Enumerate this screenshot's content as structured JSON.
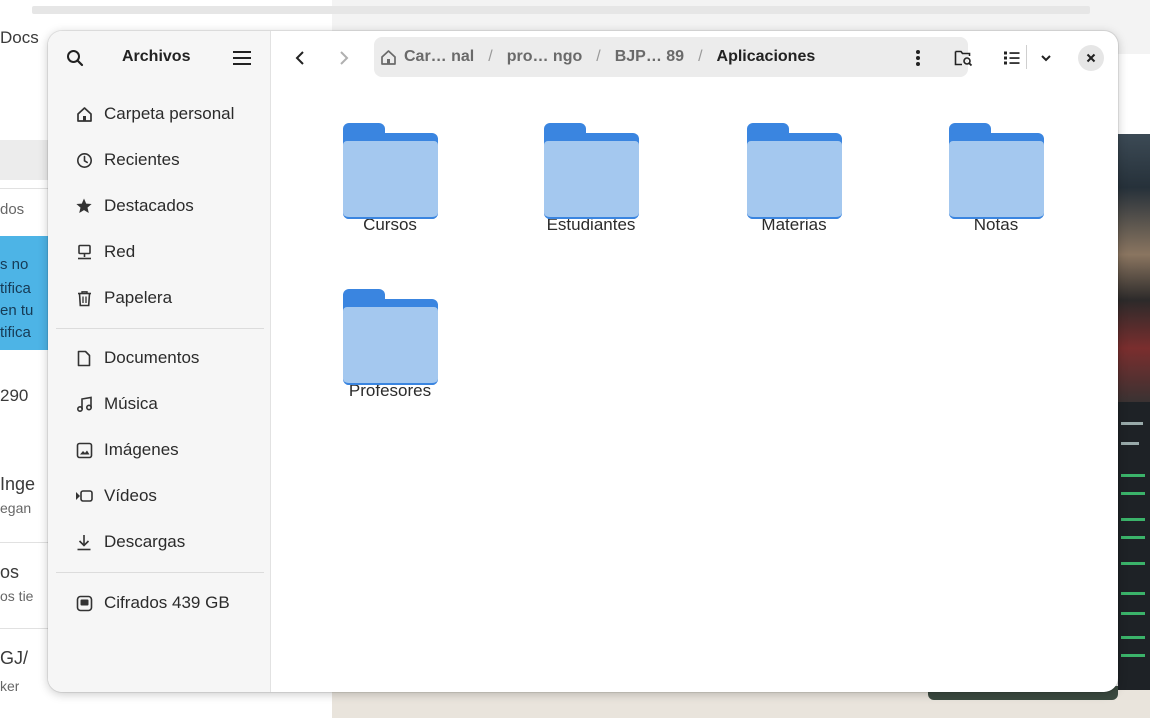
{
  "background": {
    "left_texts": [
      "Docs",
      "dos",
      "s no",
      "tifica",
      "en tu",
      "tifica",
      "290",
      "Inge",
      "egan",
      "os",
      "os tie",
      "GJ/",
      "ker"
    ]
  },
  "dialog": {
    "sidebar": {
      "title": "Archivos",
      "places": [
        {
          "label": "Carpeta personal",
          "icon": "home-icon"
        },
        {
          "label": "Recientes",
          "icon": "clock-icon"
        },
        {
          "label": "Destacados",
          "icon": "star-icon"
        },
        {
          "label": "Red",
          "icon": "network-icon"
        },
        {
          "label": "Papelera",
          "icon": "trash-icon"
        }
      ],
      "bookmarks": [
        {
          "label": "Documentos",
          "icon": "document-icon"
        },
        {
          "label": "Música",
          "icon": "music-icon"
        },
        {
          "label": "Imágenes",
          "icon": "image-icon"
        },
        {
          "label": "Vídeos",
          "icon": "video-icon"
        },
        {
          "label": "Descargas",
          "icon": "download-icon"
        }
      ],
      "devices": [
        {
          "label": "Cifrados 439 GB",
          "icon": "drive-icon"
        }
      ]
    },
    "pathbar": {
      "crumbs": [
        "Car… nal",
        "pro… ngo",
        "BJP… 89"
      ],
      "current": "Aplicaciones",
      "separator": "/"
    },
    "files": [
      {
        "name": "Cursos"
      },
      {
        "name": "Estudiantes"
      },
      {
        "name": "Materias"
      },
      {
        "name": "Notas"
      },
      {
        "name": "Profesores"
      }
    ],
    "colors": {
      "folder_dark": "#3a85e0",
      "folder_light": "#a4c8ef"
    }
  }
}
